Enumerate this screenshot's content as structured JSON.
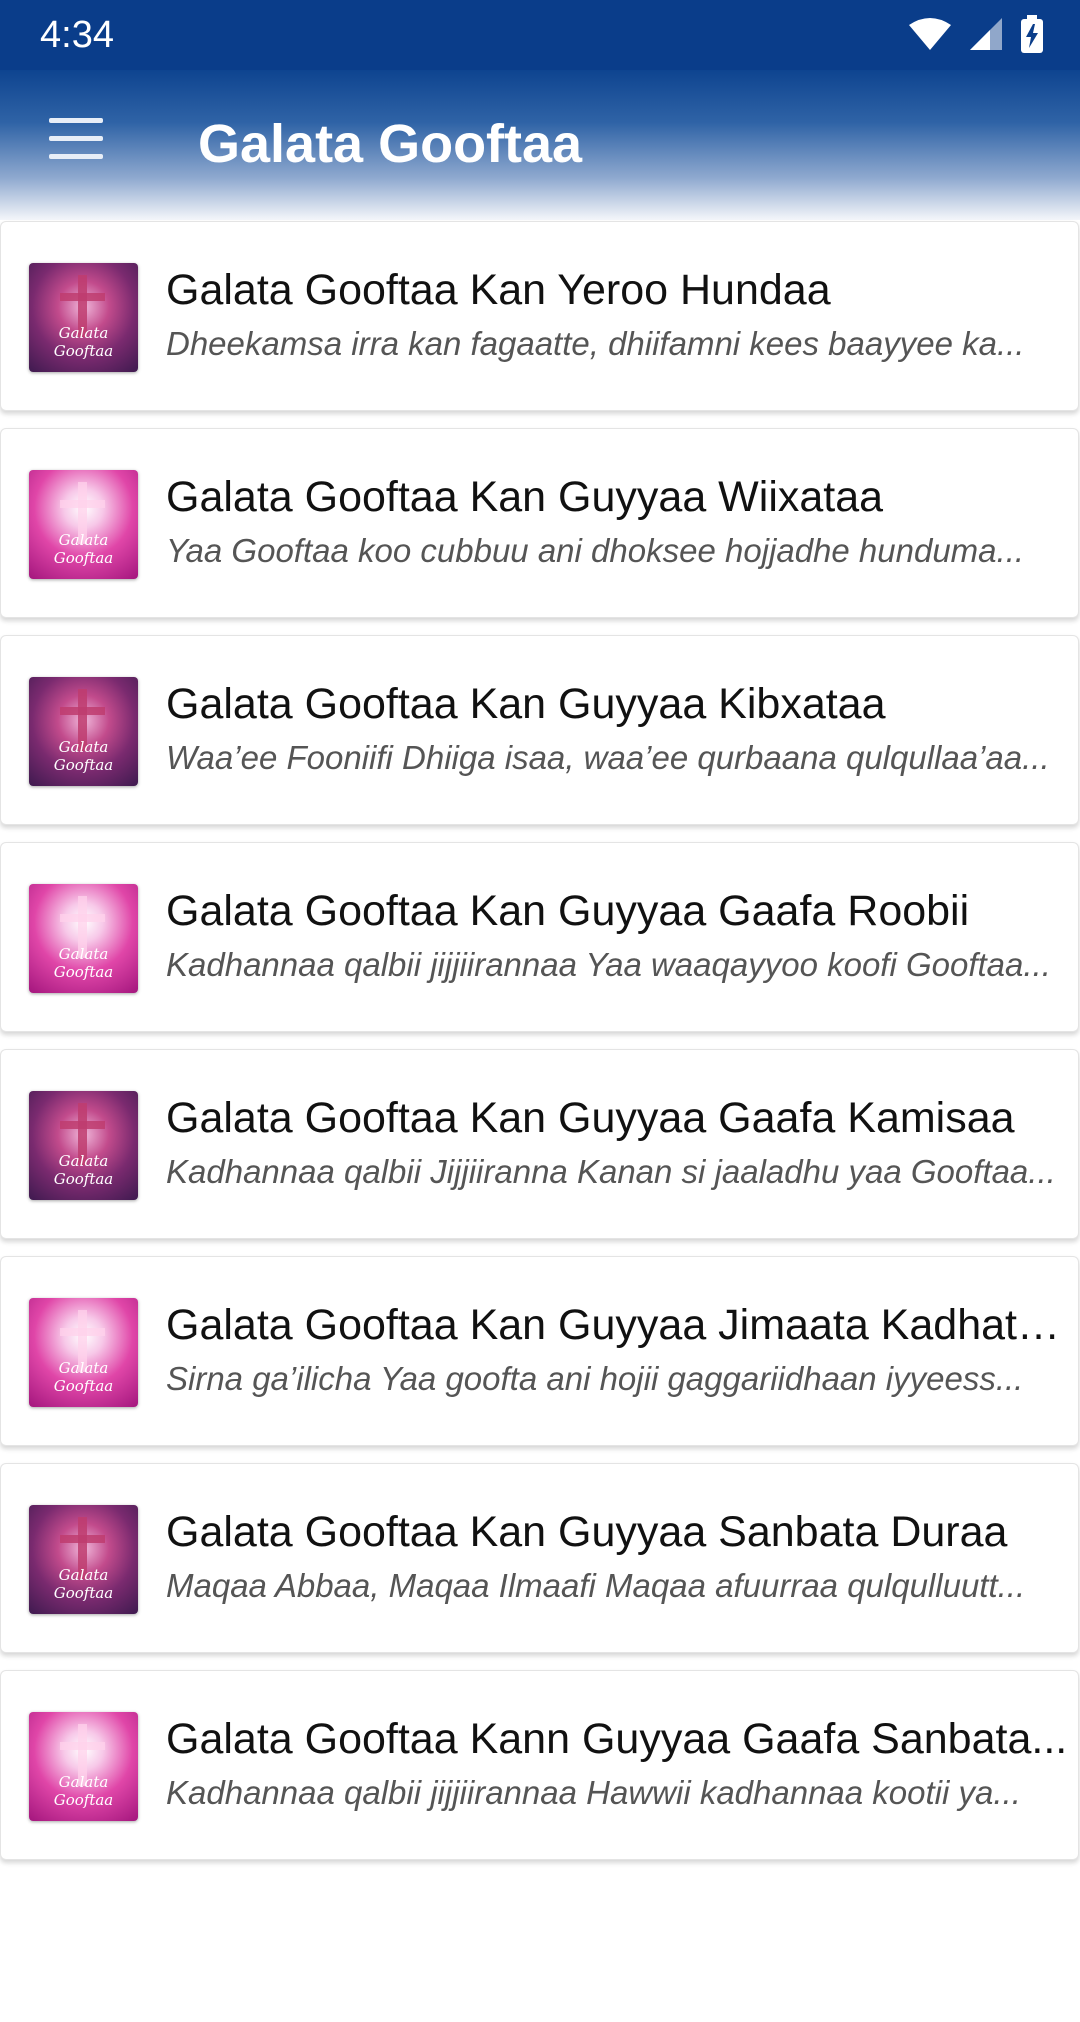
{
  "status_bar": {
    "time": "4:34",
    "icons": [
      "wifi-icon",
      "signal-icon",
      "battery-charging-icon"
    ]
  },
  "app_bar": {
    "title": "Galata Gooftaa",
    "menu_icon": "hamburger-menu-icon"
  },
  "colors": {
    "app_bar": "#0e4490",
    "status_bar": "#0a3d8a",
    "title_text": "#ffffff",
    "item_title": "#111111",
    "item_subtitle": "#555555"
  },
  "items": [
    {
      "title": "Galata Gooftaa Kan Yeroo Hundaa",
      "subtitle": "Dheekamsa irra kan fagaatte, dhiifamni kees baayyee ka...",
      "thumb_label": "Galata Gooftaa"
    },
    {
      "title": "Galata Gooftaa Kan Guyyaa Wiixataa",
      "subtitle": "Yaa Gooftaa koo cubbuu ani dhoksee hojjadhe hunduma...",
      "thumb_label": "Galata Gooftaa"
    },
    {
      "title": "Galata Gooftaa Kan Guyyaa Kibxataa",
      "subtitle": "Waa’ee Fooniifi Dhiiga isaa, waa’ee qurbaana qulqullaa’aa...",
      "thumb_label": "Galata Gooftaa"
    },
    {
      "title": "Galata Gooftaa Kan Guyyaa Gaafa Roobii",
      "subtitle": "Kadhannaa qalbii jijjiirannaa Yaa waaqayyoo koofi Gooftaa...",
      "thumb_label": "Galata Gooftaa"
    },
    {
      "title": "Galata Gooftaa Kan Guyyaa Gaafa Kamisaa",
      "subtitle": "Kadhannaa qalbii Jijjiiranna Kanan si jaaladhu yaa Gooftaa...",
      "thumb_label": "Galata Gooftaa"
    },
    {
      "title": "Galata Gooftaa Kan Guyyaa Jimaata Kadhata...",
      "subtitle": "Sirna ga’ilicha Yaa goofta ani hojii gaggariidhaan iyyeess...",
      "thumb_label": "Galata Gooftaa"
    },
    {
      "title": "Galata Gooftaa Kan Guyyaa Sanbata Duraa",
      "subtitle": "Maqaa Abbaa, Maqaa Ilmaafi Maqaa afuurraa qulqulluutt...",
      "thumb_label": "Galata Gooftaa"
    },
    {
      "title": "Galata Gooftaa Kann Guyyaa Gaafa Sanbata...",
      "subtitle": "Kadhannaa qalbii jijjiirannaa Hawwii kadhannaa kootii ya...",
      "thumb_label": "Galata Gooftaa"
    }
  ]
}
